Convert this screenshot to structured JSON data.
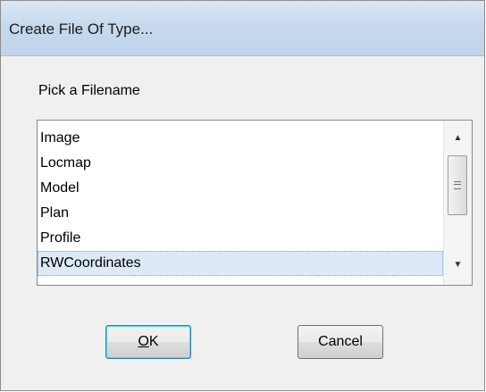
{
  "window": {
    "title": "Create File Of Type..."
  },
  "dialog": {
    "prompt": "Pick a Filename",
    "list": {
      "items": [
        "Image",
        "Locmap",
        "Model",
        "Plan",
        "Profile",
        "RWCoordinates"
      ],
      "selected_index": 5,
      "selected_value": "RWCoordinates"
    },
    "buttons": {
      "ok_label": "OK",
      "ok_accel": "O",
      "ok_rest": "K",
      "cancel_label": "Cancel"
    }
  },
  "icons": {
    "scroll_up": "scroll-up-arrow-icon",
    "scroll_down": "scroll-down-arrow-icon",
    "thumb_grip": "scroll-grip-icon"
  },
  "colors": {
    "titlebar": "#c7d9ee",
    "selection": "#dde9f7",
    "default_button_border": "#3c7fb1"
  }
}
